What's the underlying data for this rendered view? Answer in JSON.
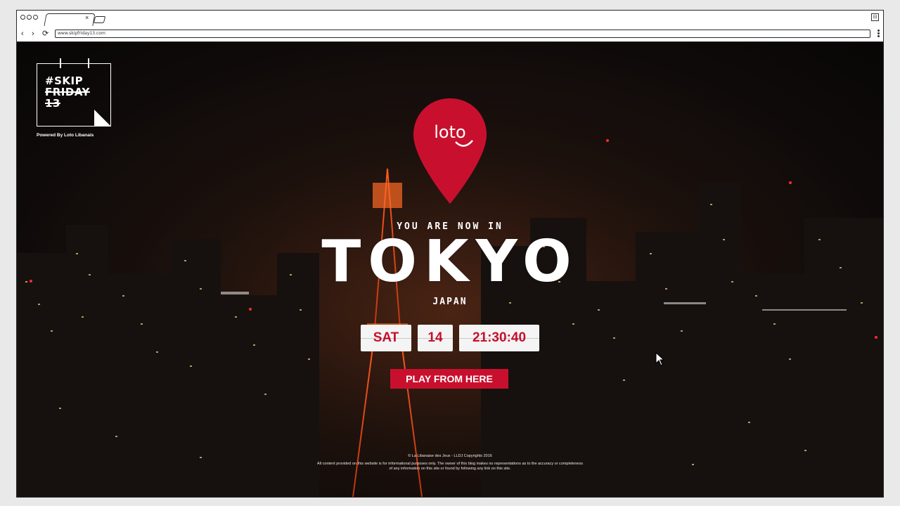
{
  "browser": {
    "tab_close": "×",
    "window_icon": "⊟",
    "nav": {
      "back": "‹",
      "forward": "›",
      "reload": "⟳"
    },
    "url": "www.skipfriday13.com"
  },
  "brand": {
    "hashtag": "#SKIP",
    "friday": "FRIDAY",
    "number": "13",
    "powered_by": "Powered By Loto Libanais"
  },
  "pin": {
    "logo_text": "loto",
    "color": "#c8102e"
  },
  "hero": {
    "intro": "YOU ARE NOW IN",
    "city": "TOKYO",
    "country": "JAPAN"
  },
  "datetime": {
    "day": "SAT",
    "date": "14",
    "time": "21:30:40"
  },
  "cta": {
    "label": "PLAY FROM HERE"
  },
  "footer": {
    "line1": "© La Libanaise des Jeux - LLDJ Copyrights 2016",
    "line2": "All content provided on this website is for informational purposes only. The owner of this blog makes no representations as to the accuracy or completeness",
    "line3": "of any information on this site or found by following any link on this site."
  },
  "colors": {
    "accent": "#c8102e",
    "text": "#ffffff",
    "date_bg": "#f4f4f4"
  }
}
